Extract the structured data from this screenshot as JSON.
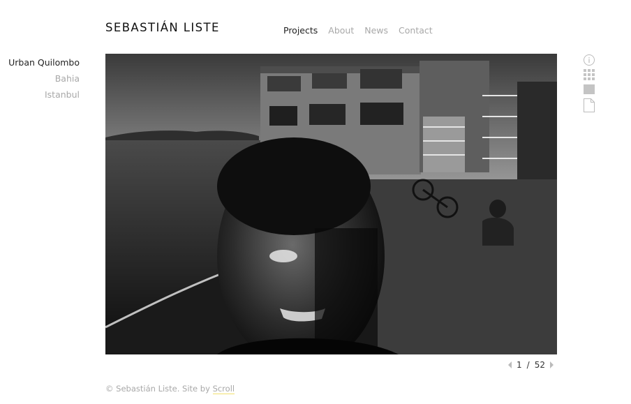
{
  "site": {
    "title": "SEBASTIÁN LISTE"
  },
  "topnav": {
    "items": [
      {
        "label": "Projects",
        "active": true
      },
      {
        "label": "About",
        "active": false
      },
      {
        "label": "News",
        "active": false
      },
      {
        "label": "Contact",
        "active": false
      }
    ]
  },
  "sidenav": {
    "items": [
      {
        "label": "Urban Quilombo",
        "active": true
      },
      {
        "label": "Bahia",
        "active": false
      },
      {
        "label": "Istanbul",
        "active": false
      }
    ]
  },
  "viewer": {
    "tools": [
      "info-icon",
      "grid-icon",
      "single-view-icon",
      "page-icon"
    ],
    "pager": {
      "current": "1",
      "separator": "/",
      "total": "52"
    }
  },
  "footer": {
    "copyright": "© Sebastián Liste. Site by",
    "credit_link": "Scroll"
  },
  "colors": {
    "text": "#222222",
    "muted": "#a8a8a8",
    "accent_underline": "#f2df6b"
  }
}
